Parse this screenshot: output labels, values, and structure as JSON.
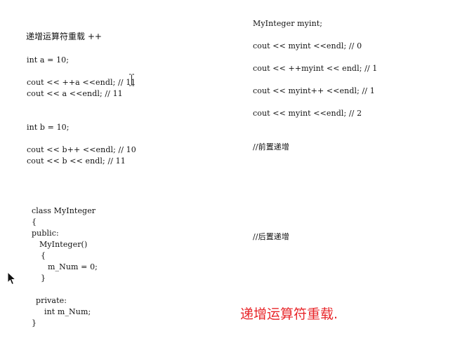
{
  "left": {
    "heading": "递增运算符重载 ++",
    "lines": [
      "int a = 10;",
      "cout << ++a <<endl; // 11",
      "cout << a <<endl; // 11",
      "int b = 10;",
      "cout << b++ <<endl; // 10",
      "cout << b << endl; // 11"
    ]
  },
  "class_code": [
    "class MyInteger",
    "{",
    "public:",
    "MyInteger()",
    "{",
    "m_Num = 0;",
    "}",
    "private:",
    "int m_Num;",
    "}"
  ],
  "right": {
    "lines": [
      "MyInteger myint;",
      "cout << myint <<endl; // 0",
      "cout << ++myint << endl; // 1",
      "cout << myint++ <<endl; // 1",
      "cout << myint <<endl; // 2",
      "//前置递增",
      "//后置递增"
    ]
  },
  "caption": {
    "text": "递增运算符重载.",
    "color": "#e8262a"
  },
  "icons": {
    "cursor_text": "i-beam-cursor-icon",
    "cursor_pointer": "arrow-pointer-icon"
  }
}
